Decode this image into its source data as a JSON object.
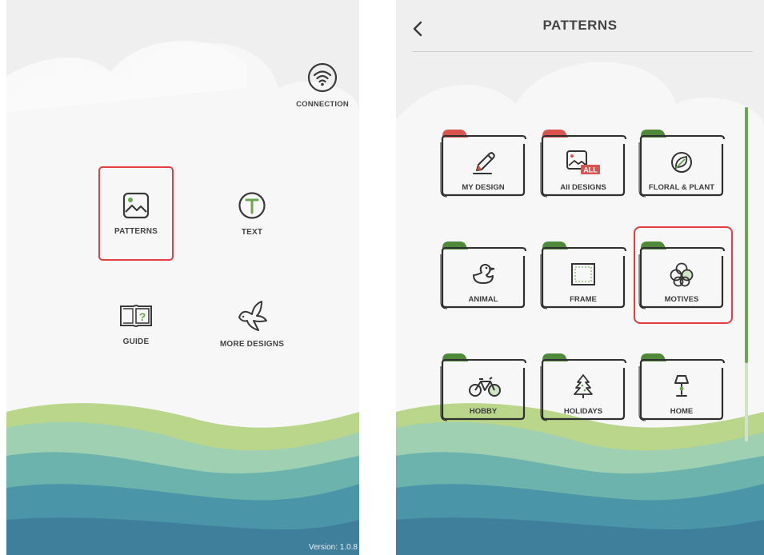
{
  "home": {
    "connection_label": "CONNECTION",
    "patterns_label": "PATTERNS",
    "text_label": "TEXT",
    "guide_label": "GUIDE",
    "more_designs_label": "MORE DESIGNS",
    "version_text": "Version: 1.0.8"
  },
  "patterns_screen": {
    "title": "PATTERNS",
    "folders": [
      {
        "label": "MY DESIGN",
        "tab_color": "#d9534f",
        "icon": "pencil-icon"
      },
      {
        "label": "All DESIGNS",
        "tab_color": "#d9534f",
        "icon": "image-all-icon"
      },
      {
        "label": "FLORAL & PLANT",
        "tab_color": "#4e8a3a",
        "icon": "leaf-icon"
      },
      {
        "label": "ANIMAL",
        "tab_color": "#4e8a3a",
        "icon": "duck-icon"
      },
      {
        "label": "FRAME",
        "tab_color": "#4e8a3a",
        "icon": "frame-icon"
      },
      {
        "label": "MOTIVES",
        "tab_color": "#4e8a3a",
        "icon": "flower-motive-icon"
      },
      {
        "label": "HOBBY",
        "tab_color": "#4e8a3a",
        "icon": "bicycle-icon"
      },
      {
        "label": "HOLIDAYS",
        "tab_color": "#4e8a3a",
        "icon": "tree-icon"
      },
      {
        "label": "HOME",
        "tab_color": "#4e8a3a",
        "icon": "lamp-icon"
      }
    ],
    "all_badge": "ALL"
  },
  "colors": {
    "highlight": "#e23f3f",
    "accent_green": "#6aa84f",
    "tab_red": "#d9534f",
    "tab_green": "#4e8a3a"
  }
}
